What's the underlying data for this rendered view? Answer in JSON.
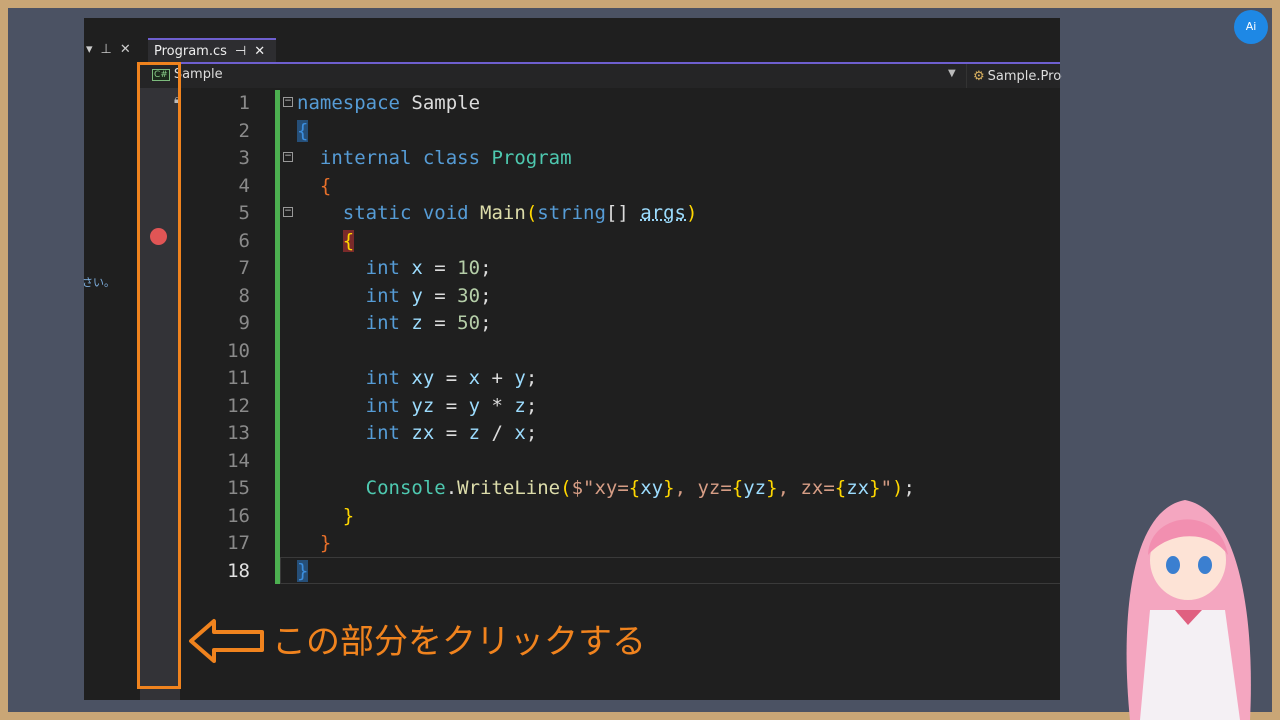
{
  "left_pane": {
    "text": "さい。"
  },
  "tab": {
    "label": "Program.cs",
    "pin": "⊣",
    "close": "✕"
  },
  "navbar": {
    "project": "Sample",
    "class": "Sample.Program",
    "cs_badge": "C#"
  },
  "code_lines": [
    {
      "n": "1",
      "fold": "⊟",
      "tokens": [
        [
          "namespace ",
          "k"
        ],
        [
          "Sample",
          ""
        ]
      ]
    },
    {
      "n": "2",
      "tokens": [
        [
          "{",
          "b1"
        ]
      ]
    },
    {
      "n": "3",
      "fold": "⊟",
      "tokens": [
        [
          "  internal ",
          "k"
        ],
        [
          "class ",
          "k"
        ],
        [
          "Program",
          "t"
        ]
      ]
    },
    {
      "n": "4",
      "tokens": [
        [
          "  {",
          "b2"
        ]
      ]
    },
    {
      "n": "5",
      "fold": "⊟",
      "tokens": [
        [
          "    static ",
          "k"
        ],
        [
          "void ",
          "k"
        ],
        [
          "Main",
          "m"
        ],
        [
          "(",
          "y"
        ],
        [
          "string",
          "k"
        ],
        [
          "[] ",
          ""
        ],
        [
          "args",
          "v ul"
        ],
        [
          ")",
          "y"
        ]
      ]
    },
    {
      "n": "6",
      "tokens": [
        [
          "    ",
          ""
        ],
        [
          "{",
          "b3"
        ]
      ]
    },
    {
      "n": "7",
      "tokens": [
        [
          "      int ",
          "k"
        ],
        [
          "x",
          "v"
        ],
        [
          " = ",
          ""
        ],
        [
          "10",
          "n"
        ],
        [
          ";",
          ""
        ]
      ]
    },
    {
      "n": "8",
      "tokens": [
        [
          "      int ",
          "k"
        ],
        [
          "y",
          "v"
        ],
        [
          " = ",
          ""
        ],
        [
          "30",
          "n"
        ],
        [
          ";",
          ""
        ]
      ]
    },
    {
      "n": "9",
      "tokens": [
        [
          "      int ",
          "k"
        ],
        [
          "z",
          "v"
        ],
        [
          " = ",
          ""
        ],
        [
          "50",
          "n"
        ],
        [
          ";",
          ""
        ]
      ]
    },
    {
      "n": "10",
      "tokens": []
    },
    {
      "n": "11",
      "tokens": [
        [
          "      int ",
          "k"
        ],
        [
          "xy",
          "v"
        ],
        [
          " = ",
          ""
        ],
        [
          "x",
          "v"
        ],
        [
          " + ",
          ""
        ],
        [
          "y",
          "v"
        ],
        [
          ";",
          ""
        ]
      ]
    },
    {
      "n": "12",
      "tokens": [
        [
          "      int ",
          "k"
        ],
        [
          "yz",
          "v"
        ],
        [
          " = ",
          ""
        ],
        [
          "y",
          "v"
        ],
        [
          " * ",
          ""
        ],
        [
          "z",
          "v"
        ],
        [
          ";",
          ""
        ]
      ]
    },
    {
      "n": "13",
      "tokens": [
        [
          "      int ",
          "k"
        ],
        [
          "zx",
          "v"
        ],
        [
          " = ",
          ""
        ],
        [
          "z",
          "v"
        ],
        [
          " / ",
          ""
        ],
        [
          "x",
          "v"
        ],
        [
          ";",
          ""
        ]
      ]
    },
    {
      "n": "14",
      "tokens": []
    },
    {
      "n": "15",
      "tokens": [
        [
          "      Console",
          "t"
        ],
        [
          ".",
          ""
        ],
        [
          "WriteLine",
          "m"
        ],
        [
          "(",
          "y"
        ],
        [
          "$\"xy=",
          "s"
        ],
        [
          "{",
          "y"
        ],
        [
          "xy",
          "v"
        ],
        [
          "}",
          "y"
        ],
        [
          ", yz=",
          "s"
        ],
        [
          "{",
          "y"
        ],
        [
          "yz",
          "v"
        ],
        [
          "}",
          "y"
        ],
        [
          ", zx=",
          "s"
        ],
        [
          "{",
          "y"
        ],
        [
          "zx",
          "v"
        ],
        [
          "}",
          "y"
        ],
        [
          "\"",
          "s"
        ],
        [
          ")",
          "y"
        ],
        [
          ";",
          ""
        ]
      ]
    },
    {
      "n": "16",
      "tokens": [
        [
          "    }",
          "y"
        ]
      ]
    },
    {
      "n": "17",
      "tokens": [
        [
          "  }",
          "b2"
        ]
      ]
    },
    {
      "n": "18",
      "current": true,
      "tokens": [
        [
          "}",
          "b1"
        ]
      ]
    }
  ],
  "annotation": {
    "text": "この部分をクリックする",
    "color": "#f0831e"
  },
  "logo": {
    "text": "Ai"
  }
}
